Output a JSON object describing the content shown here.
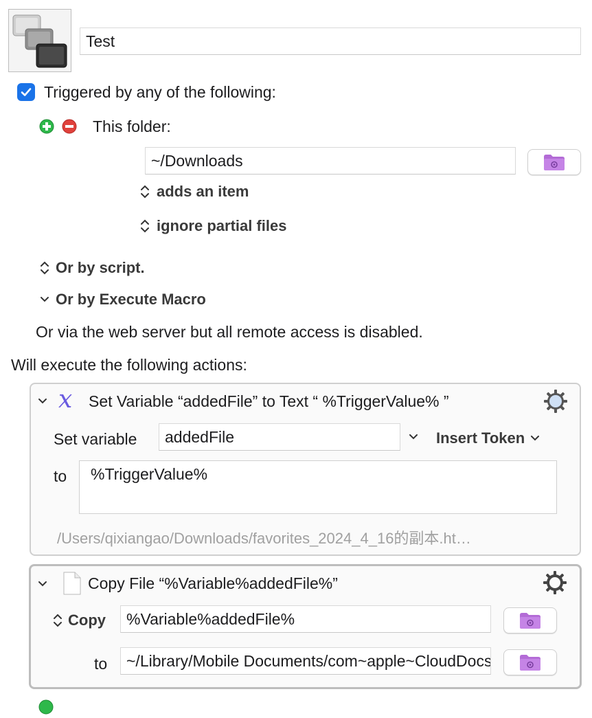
{
  "macro": {
    "name": "Test"
  },
  "trigger": {
    "header": "Triggered by any of the following:",
    "checked": true,
    "folder_label": "This folder:",
    "folder_path": "~/Downloads",
    "event": "adds an item",
    "option": "ignore partial files",
    "by_script": "Or by script.",
    "by_execute": "Or by Execute Macro",
    "web_server": "Or via the web server but all remote access is disabled."
  },
  "actions_header": "Will execute the following actions:",
  "actions": [
    {
      "title": "Set Variable “addedFile” to Text “ %TriggerValue% ”",
      "set_label": "Set variable",
      "variable": "addedFile",
      "insert_token": "Insert Token",
      "to_label": "to",
      "text_value": "%TriggerValue%",
      "preview": "/Users/qixiangao/Downloads/favorites_2024_4_16的副本.ht…"
    },
    {
      "title": "Copy File “%Variable%addedFile%”",
      "copy_label": "Copy",
      "copy_value": "%Variable%addedFile%",
      "to_label": "to",
      "to_value": "~/Library/Mobile Documents/com~apple~CloudDocs"
    }
  ],
  "colors": {
    "accent": "#1a73e8",
    "add": "#2eb84a",
    "remove": "#e0413c",
    "folder": "#b36bd6"
  }
}
